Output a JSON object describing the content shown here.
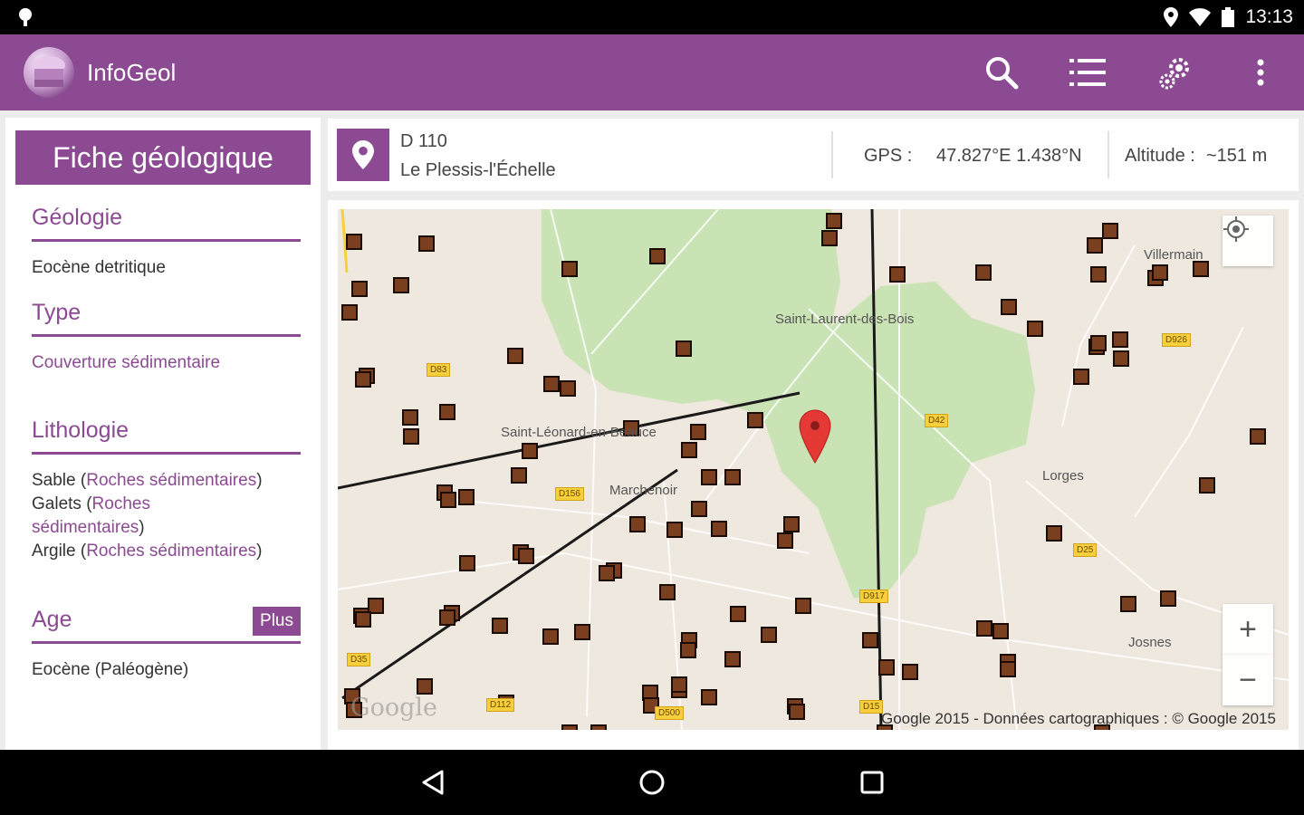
{
  "status_bar": {
    "time": "13:13",
    "icons": [
      "android-notification-icon",
      "location-icon",
      "wifi-icon",
      "battery-icon"
    ]
  },
  "app_bar": {
    "title": "InfoGeol",
    "actions": [
      "search-icon",
      "list-icon",
      "settings-icon",
      "overflow-menu-icon"
    ],
    "color": "#8b4a92"
  },
  "fiche": {
    "header": "Fiche géologique",
    "geologie": {
      "title": "Géologie",
      "value": "Eocène detritique"
    },
    "type": {
      "title": "Type",
      "value": "Couverture sédimentaire"
    },
    "lithologie": {
      "title": "Lithologie",
      "items": [
        {
          "name": "Sable",
          "category": "Roches sédimentaires",
          "open": "(",
          "close": ")"
        },
        {
          "name": "Galets",
          "category_line1": "Roches",
          "category_line2": "sédimentaires",
          "open": "(",
          "close": ")"
        },
        {
          "name": "Argile",
          "category": "Roches sédimentaires",
          "open": "(",
          "close": ")"
        }
      ]
    },
    "age": {
      "title": "Age",
      "more_button": "Plus",
      "value": "Eocène (Paléogène)"
    }
  },
  "location": {
    "road": "D 110",
    "town": "Le Plessis-l'Échelle",
    "gps_label": "GPS :",
    "gps_value": "47.827°E 1.438°N",
    "altitude_label": "Altitude :",
    "altitude_value": "~151 m"
  },
  "map": {
    "place_labels": [
      "Saint-Laurent-des-Bois",
      "Saint-Léonard-en-Beauce",
      "Marchenoir",
      "Lorges",
      "Villermain",
      "Josnes"
    ],
    "road_badges": [
      "D83",
      "D42",
      "D156",
      "D926",
      "D25",
      "D917",
      "D35",
      "D112",
      "D500",
      "D15"
    ],
    "logo": "Google",
    "copyright": "Google 2015 - Données cartographiques : © Google 2015",
    "zoom_in": "+",
    "zoom_out": "−",
    "colors": {
      "forest": "#c9e3b5",
      "land": "#efe8de",
      "marker": "#7a3f1f",
      "pin": "#e53935"
    }
  },
  "nav_bar": {
    "buttons": [
      "back-icon",
      "home-icon",
      "recents-icon"
    ]
  }
}
